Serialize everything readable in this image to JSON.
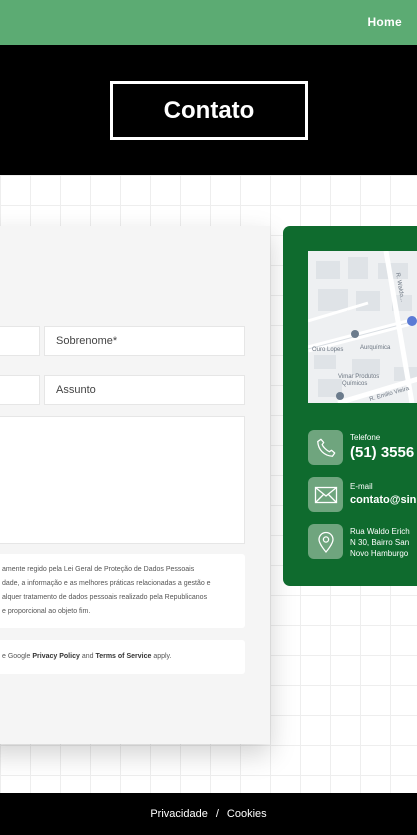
{
  "nav": {
    "home_label": "Home"
  },
  "hero": {
    "title": "Contato"
  },
  "form": {
    "sobrenome_placeholder": "Sobrenome*",
    "assunto_placeholder": "Assunto",
    "lgpd_lines": [
      "amente regido pela Lei Geral de Proteção de Dados Pessoais",
      "dade, a informação e as melhores práticas relacionadas a gestão e",
      "alquer tratamento de dados pessoais realizado pela Republicanos",
      "e proporcional ao objeto fim."
    ],
    "recaptcha_prefix": "e Google",
    "privacy_link": "Privacy Policy",
    "and_text": "and",
    "terms_link": "Terms of Service",
    "apply_text": "apply."
  },
  "map": {
    "labels": [
      "Aurquímica",
      "Ouro Lopes",
      "Vimar Produtos",
      "Químicos",
      "R. Emilio Vieira",
      "R. Waldo..."
    ]
  },
  "contact": {
    "phone_label": "Telefone",
    "phone_value": "(51) 3556",
    "email_label": "E-mail",
    "email_value": "contato@sin",
    "address_lines": [
      "Rua Waldo Erich",
      "N 30, Bairro San",
      "Novo Hamburgo"
    ]
  },
  "footer": {
    "privacy": "Privacidade",
    "separator": "/",
    "cookies": "Cookies"
  },
  "colors": {
    "nav_green": "#5cab73",
    "card_green": "#0f6b2e",
    "icon_bg": "#6fa57e"
  },
  "icons": [
    "phone-icon",
    "envelope-icon",
    "map-pin-icon"
  ]
}
